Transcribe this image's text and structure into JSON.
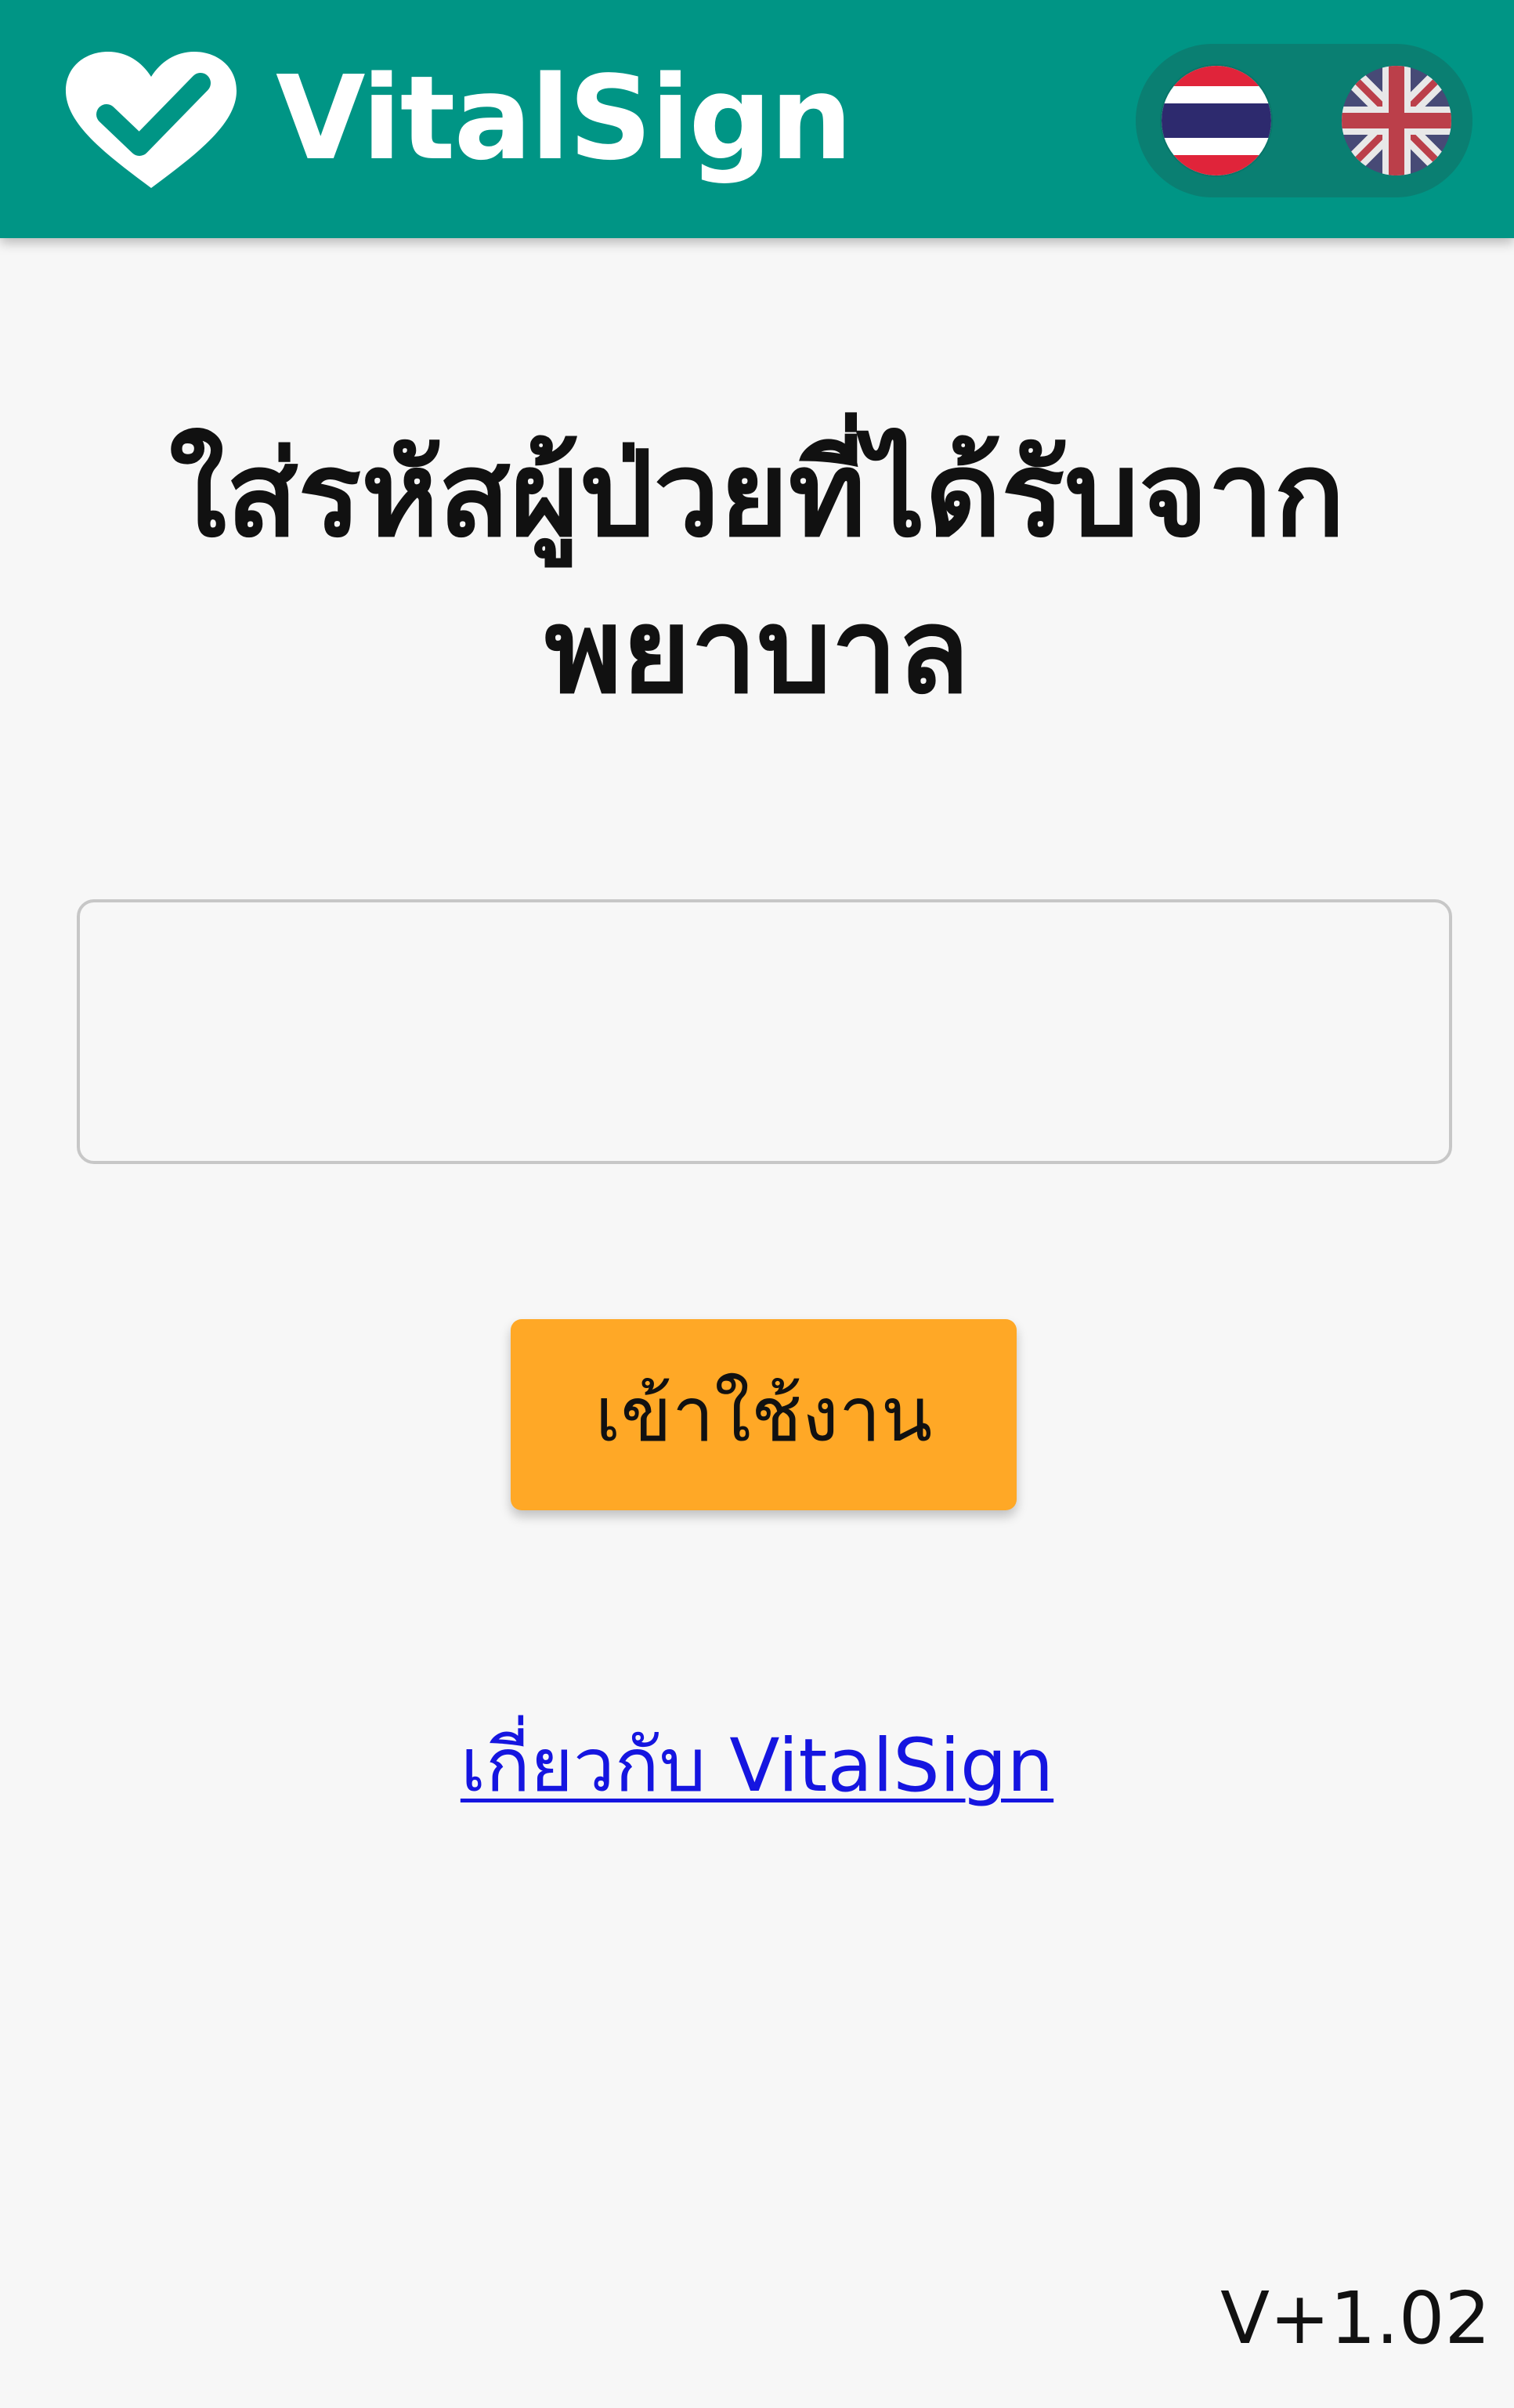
{
  "header": {
    "brand": "VitalSign",
    "logo_icon": "heart-check-icon",
    "languages": [
      {
        "code": "th",
        "icon": "thailand-flag-icon"
      },
      {
        "code": "en",
        "icon": "uk-flag-icon"
      }
    ]
  },
  "main": {
    "title": "ใส่รหัสผู้ป่วยที่ได้รับจากพยาบาล",
    "code_input": {
      "value": "",
      "placeholder": ""
    },
    "login_button_label": "เข้าใช้งาน",
    "about_link": "เกี่ยวกับ VitalSign"
  },
  "footer": {
    "version": "V+1.02"
  },
  "colors": {
    "header": "#009585",
    "lang_switch": "#0a7f72",
    "button": "#ffa826",
    "link": "#1515e0",
    "background": "#f7f7f7"
  }
}
